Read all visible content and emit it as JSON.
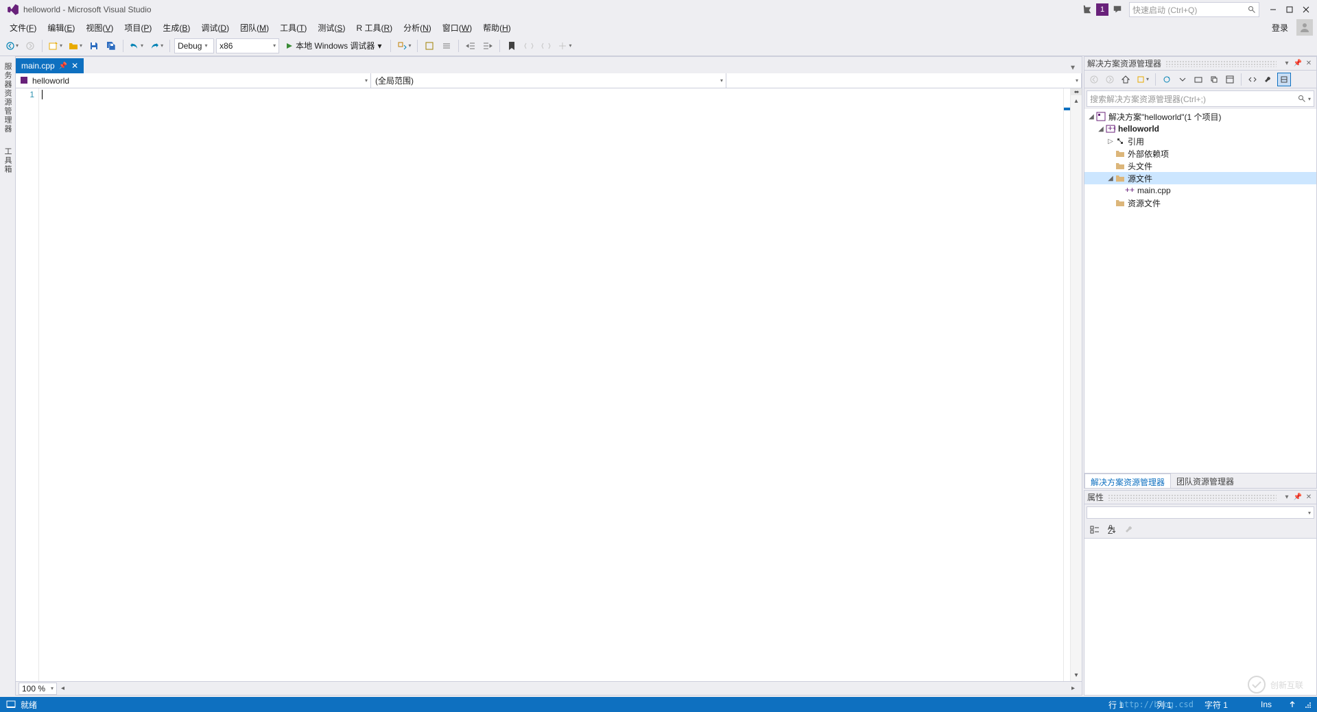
{
  "titlebar": {
    "title": "helloworld - Microsoft Visual Studio",
    "notif_count": "1",
    "quick_launch_placeholder": "快速启动 (Ctrl+Q)"
  },
  "menubar": {
    "items": [
      {
        "label": "文件(F)",
        "u": "F"
      },
      {
        "label": "编辑(E)",
        "u": "E"
      },
      {
        "label": "视图(V)",
        "u": "V"
      },
      {
        "label": "项目(P)",
        "u": "P"
      },
      {
        "label": "生成(B)",
        "u": "B"
      },
      {
        "label": "调试(D)",
        "u": "D"
      },
      {
        "label": "团队(M)",
        "u": "M"
      },
      {
        "label": "工具(T)",
        "u": "T"
      },
      {
        "label": "测试(S)",
        "u": "S"
      },
      {
        "label": "R 工具(R)",
        "u": "R"
      },
      {
        "label": "分析(N)",
        "u": "N"
      },
      {
        "label": "窗口(W)",
        "u": "W"
      },
      {
        "label": "帮助(H)",
        "u": "H"
      }
    ],
    "login": "登录"
  },
  "toolbar": {
    "config": "Debug",
    "platform": "x86",
    "run_label": "本地 Windows 调试器"
  },
  "left_dock": {
    "tab1": "服务器资源管理器",
    "tab2": "工具箱"
  },
  "editor": {
    "tab_name": "main.cpp",
    "context_scope": "helloworld",
    "context_function": "(全局范围)",
    "line_number": "1",
    "zoom": "100 %"
  },
  "solution_explorer": {
    "title": "解决方案资源管理器",
    "search_placeholder": "搜索解决方案资源管理器(Ctrl+;)",
    "solution_label": "解决方案\"helloworld\"(1 个项目)",
    "project": "helloworld",
    "nodes": {
      "references": "引用",
      "external_deps": "外部依赖项",
      "headers": "头文件",
      "sources": "源文件",
      "main_cpp": "main.cpp",
      "resources": "资源文件"
    },
    "bottom_tabs": {
      "active": "解决方案资源管理器",
      "inactive": "团队资源管理器"
    }
  },
  "properties": {
    "title": "属性"
  },
  "statusbar": {
    "status": "就绪",
    "line": "行 1",
    "col": "列 1",
    "char": "字符 1",
    "ins": "Ins"
  },
  "watermark": {
    "brand": "创新互联",
    "url": "http://blog.csd"
  }
}
